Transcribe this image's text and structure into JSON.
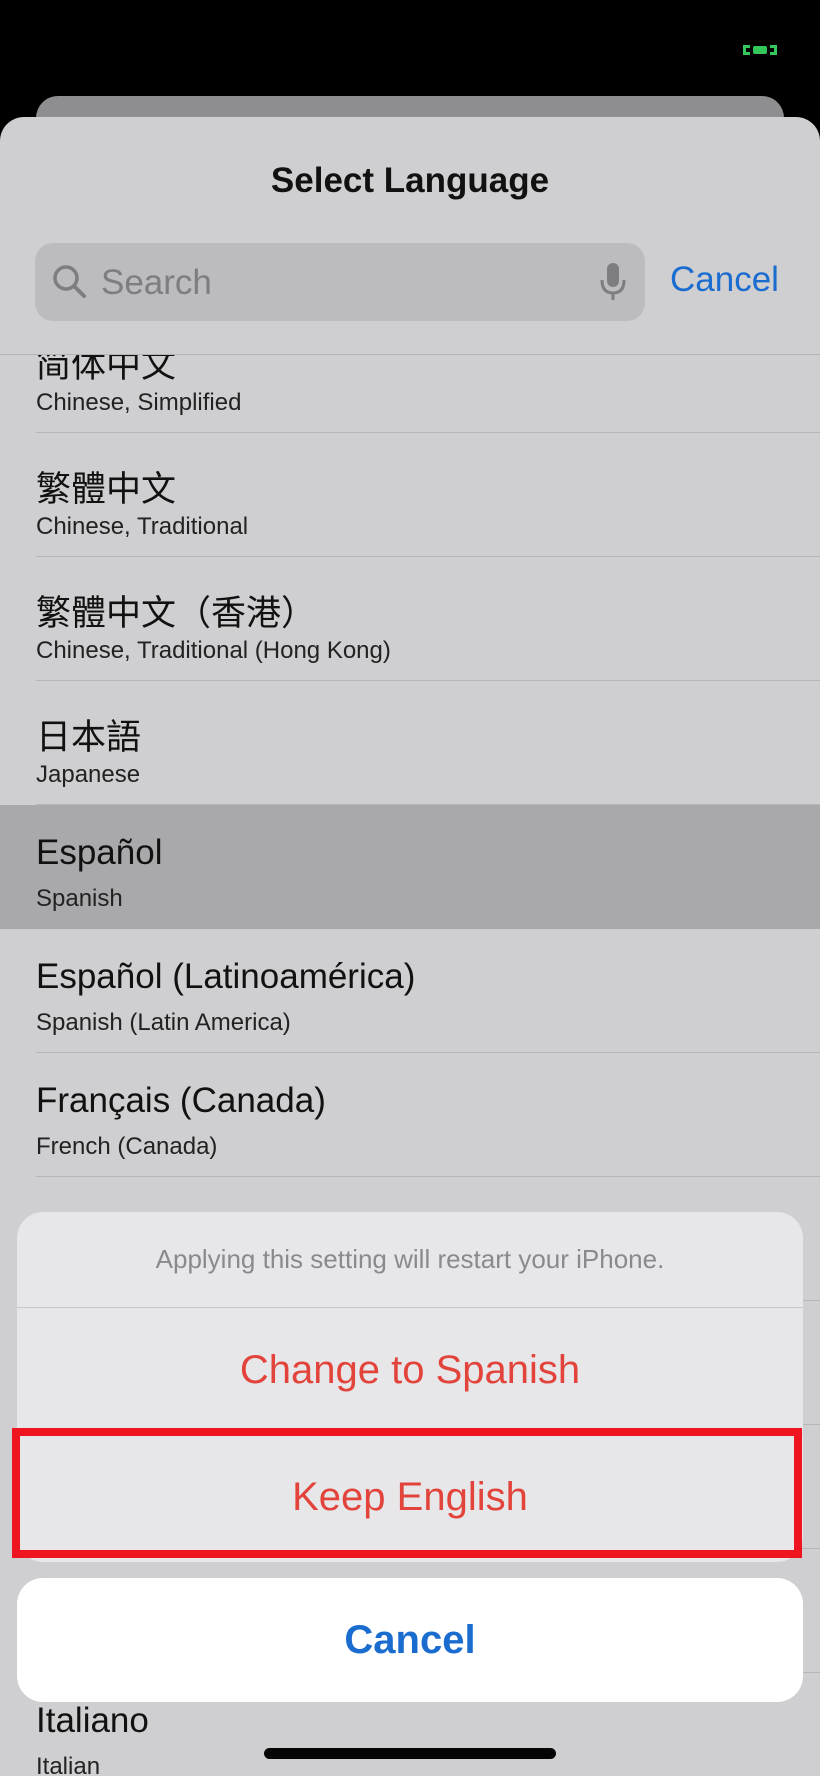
{
  "sheet": {
    "title": "Select Language"
  },
  "search": {
    "placeholder": "Search",
    "cancel_label": "Cancel"
  },
  "languages": [
    {
      "native": "简体中文",
      "english": "Chinese, Simplified",
      "selected": false
    },
    {
      "native": "繁體中文",
      "english": "Chinese, Traditional",
      "selected": false
    },
    {
      "native": "繁體中文（香港）",
      "english": "Chinese, Traditional (Hong Kong)",
      "selected": false
    },
    {
      "native": "日本語",
      "english": "Japanese",
      "selected": false
    },
    {
      "native": "Español",
      "english": "Spanish",
      "selected": true
    },
    {
      "native": "Español (Latinoamérica)",
      "english": "Spanish (Latin America)",
      "selected": false
    },
    {
      "native": "Français (Canada)",
      "english": "French (Canada)",
      "selected": false
    },
    {
      "native": "",
      "english": "",
      "selected": false
    },
    {
      "native": "",
      "english": "",
      "selected": false
    },
    {
      "native": "",
      "english": "",
      "selected": false
    },
    {
      "native": "",
      "english": "",
      "selected": false
    },
    {
      "native": "Italiano",
      "english": "Italian",
      "selected": false
    }
  ],
  "action_sheet": {
    "message": "Applying this setting will restart your iPhone.",
    "change_label": "Change to Spanish",
    "keep_label": "Keep English",
    "cancel_label": "Cancel"
  },
  "icons": {
    "search": "search-icon",
    "mic": "microphone-icon"
  },
  "colors": {
    "accent_blue": "#1a6ccf",
    "destructive_red": "#e2443c",
    "highlight_red": "#ee1420",
    "status_green": "#34c759"
  }
}
